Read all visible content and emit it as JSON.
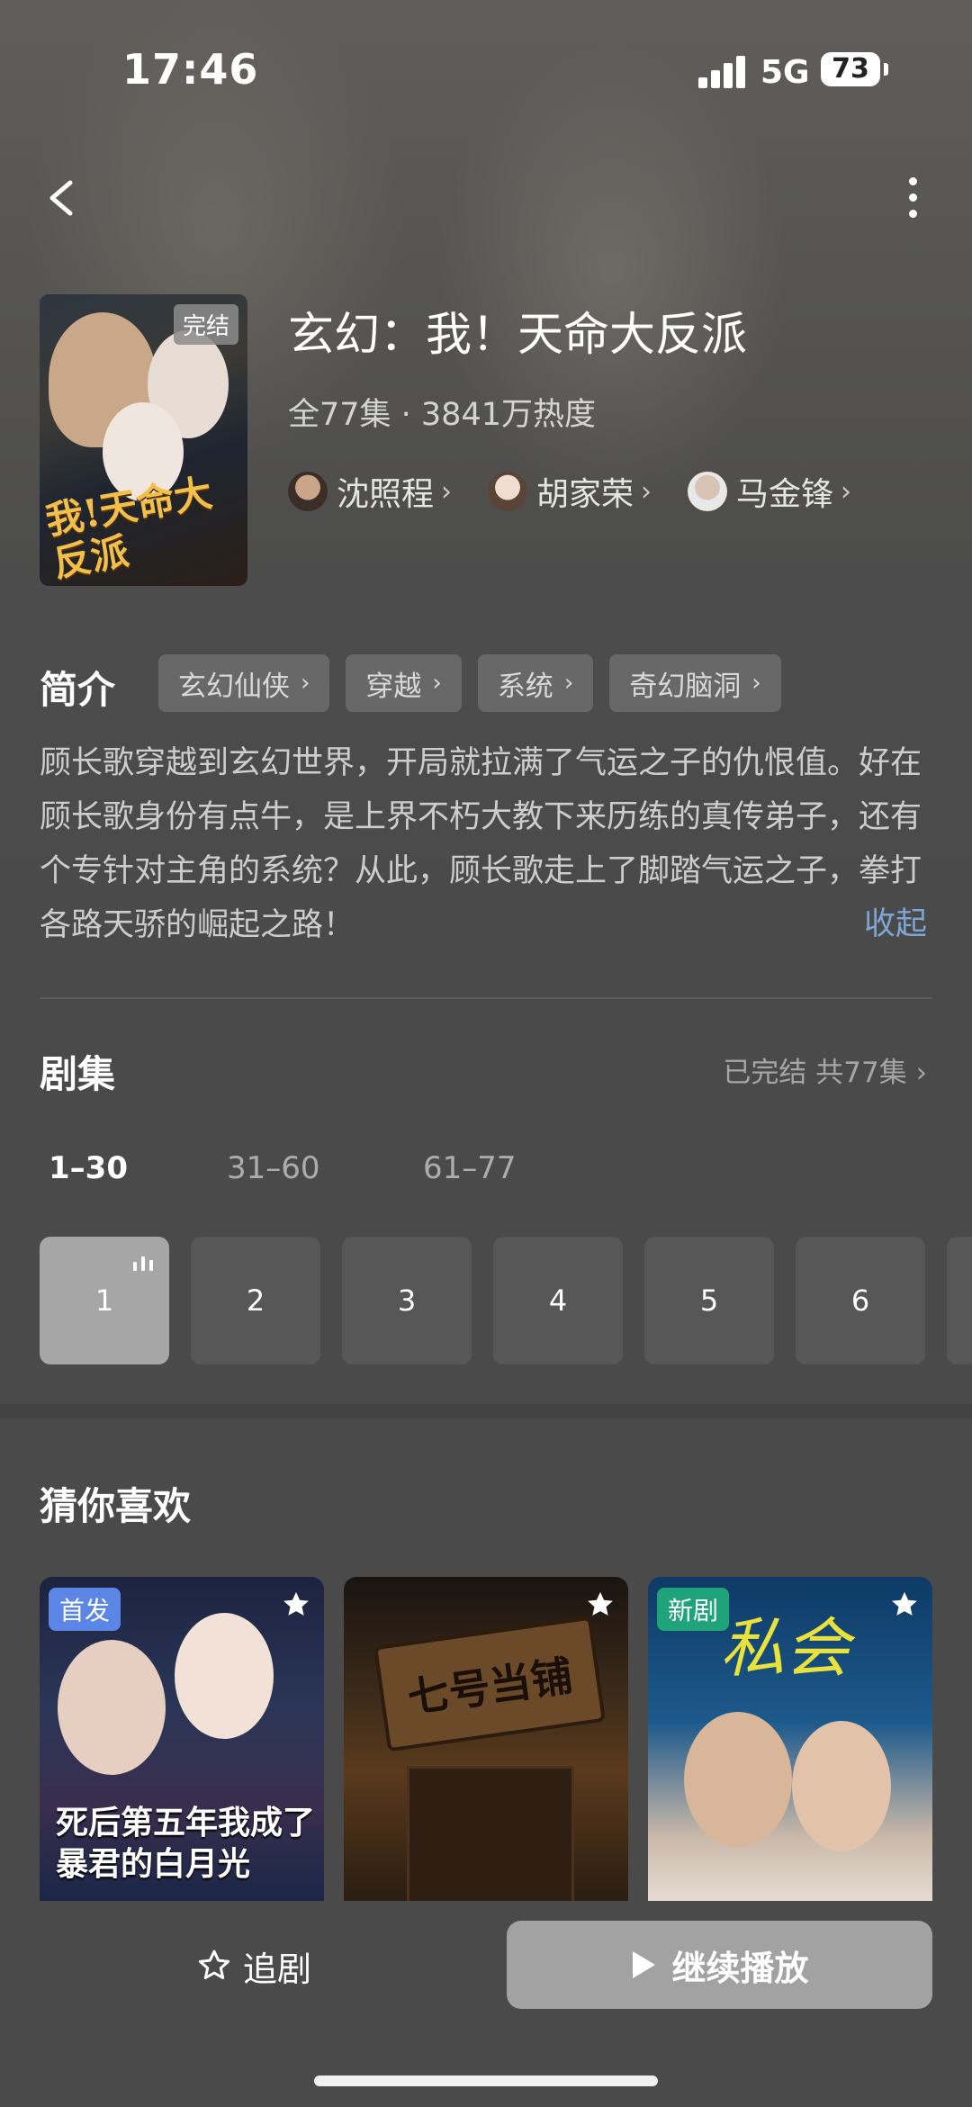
{
  "status_bar": {
    "time": "17:46",
    "network": "5G",
    "battery": "73"
  },
  "drama": {
    "poster_badge": "完结",
    "poster_title": "我!天命大反派",
    "title": "玄幻：我！天命大反派",
    "meta": "全77集 · 3841万热度",
    "cast": [
      {
        "name": "沈照程"
      },
      {
        "name": "胡家荣"
      },
      {
        "name": "马金锋"
      }
    ]
  },
  "intro": {
    "label": "简介",
    "tags": [
      "玄幻仙侠",
      "穿越",
      "系统",
      "奇幻脑洞"
    ],
    "synopsis": "顾长歌穿越到玄幻世界，开局就拉满了气运之子的仇恨值。好在顾长歌身份有点牛，是上界不朽大教下来历练的真传弟子，还有个专针对主角的系统？从此，顾长歌走上了脚踏气运之子，拳打各路天骄的崛起之路！",
    "collapse_label": "收起"
  },
  "episodes": {
    "label": "剧集",
    "status": "已完结 共77集",
    "ranges": [
      "1–30",
      "31–60",
      "61–77"
    ],
    "active_range": 0,
    "items": [
      "1",
      "2",
      "3",
      "4",
      "5",
      "6"
    ],
    "playing": 0
  },
  "recommend": {
    "label": "猜你喜欢",
    "cards": [
      {
        "badge": "首发",
        "badge_color": "#5b86e5",
        "title": "死后第五年我成了暴君的白月光"
      },
      {
        "badge": "",
        "badge_color": "",
        "title": "七号当铺"
      },
      {
        "badge": "新剧",
        "badge_color": "#1fa37a",
        "title": "私会"
      }
    ]
  },
  "bottom": {
    "follow_label": "追剧",
    "play_label": "继续播放"
  },
  "icons": {
    "back": "chevron-left-icon",
    "more": "more-vertical-icon",
    "star": "star-icon",
    "play": "play-icon",
    "playing": "equalizer-icon"
  },
  "colors": {
    "accent_link": "#7fa6d6",
    "background": "#4a4a4a",
    "play_button": "#a2a2a2"
  }
}
